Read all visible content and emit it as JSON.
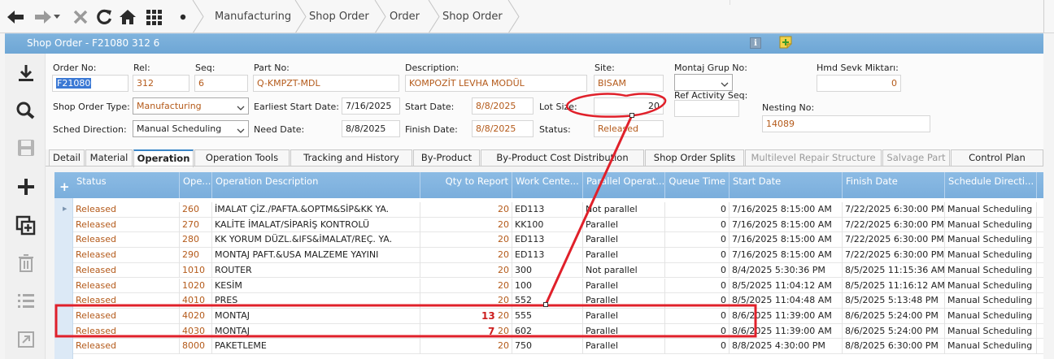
{
  "breadcrumb": [
    "Manufacturing",
    "Shop Order",
    "Order",
    "Shop Order"
  ],
  "title": "Shop Order - F21080 312 6",
  "form": {
    "order_no_label": "Order No:",
    "order_no": "F21080",
    "rel_label": "Rel:",
    "rel": "312",
    "seq_label": "Seq:",
    "seq": "6",
    "part_no_label": "Part No:",
    "part_no": "Q-KMPZT-MDL",
    "description_label": "Description:",
    "description": "KOMPOZİT LEVHA MODÜL",
    "site_label": "Site:",
    "site": "BISAM",
    "montaj_grup_label": "Montaj Grup No:",
    "hmd_sevk_label": "Hmd Sevk Miktarı:",
    "hmd_sevk": "0",
    "shop_order_type_label": "Shop Order Type:",
    "shop_order_type": "Manufacturing",
    "earliest_start_label": "Earliest Start Date:",
    "earliest_start": "7/16/2025",
    "start_date_label": "Start Date:",
    "start_date": "8/8/2025",
    "lot_size_label": "Lot Size:",
    "lot_size": "20",
    "ref_activity_label": "Ref Activity Seq:",
    "nesting_label": "Nesting No:",
    "nesting": "14089",
    "sched_direction_label": "Sched Direction:",
    "sched_direction": "Manual Scheduling",
    "need_date_label": "Need Date:",
    "need_date": "8/8/2025",
    "finish_date_label": "Finish Date:",
    "finish_date": "8/8/2025",
    "status_label": "Status:",
    "status": "Released"
  },
  "tabs": [
    {
      "label": "Detail"
    },
    {
      "label": "Material"
    },
    {
      "label": "Operation"
    },
    {
      "label": "Operation Tools"
    },
    {
      "label": "Tracking and History"
    },
    {
      "label": "By-Product"
    },
    {
      "label": "By-Product Cost Distribution"
    },
    {
      "label": "Shop Order Splits"
    },
    {
      "label": "Multilevel Repair Structure"
    },
    {
      "label": "Salvage Part"
    },
    {
      "label": "Control Plan"
    }
  ],
  "grid": {
    "columns": [
      "Status",
      "Ope...",
      "Operation Description",
      "Qty to Report",
      "Work Cente...",
      "Parallel Operat...",
      "Queue Time",
      "Start Date",
      "Finish Date",
      "Schedule Directi..."
    ],
    "rows": [
      {
        "status": "Released",
        "op": "260",
        "desc": "İMALAT ÇİZ./PAFTA.&OPTM&SİP&KK YA.",
        "qty": "20",
        "wc": "ED113",
        "parallel": "Not parallel",
        "queue": "0",
        "start": "7/16/2025 8:15:00 AM",
        "finish": "7/22/2025 6:30:00 PM",
        "sched": "Manual Scheduling",
        "extra": ""
      },
      {
        "status": "Released",
        "op": "270",
        "desc": "KALİTE İMALAT/SİPARİŞ KONTROLÜ",
        "qty": "20",
        "wc": "KK100",
        "parallel": "Parallel",
        "queue": "0",
        "start": "7/16/2025 8:15:00 AM",
        "finish": "7/22/2025 6:30:00 PM",
        "sched": "Manual Scheduling",
        "extra": ""
      },
      {
        "status": "Released",
        "op": "280",
        "desc": "KK YORUM DÜZL.&IFS&İMALAT/REÇ. YA.",
        "qty": "20",
        "wc": "ED113",
        "parallel": "Parallel",
        "queue": "0",
        "start": "7/16/2025 8:15:00 AM",
        "finish": "7/22/2025 6:30:00 PM",
        "sched": "Manual Scheduling",
        "extra": ""
      },
      {
        "status": "Released",
        "op": "290",
        "desc": "MONTAJ PAFT.&USA MALZEME YAYINI",
        "qty": "20",
        "wc": "ED113",
        "parallel": "Parallel",
        "queue": "0",
        "start": "7/16/2025 8:15:00 AM",
        "finish": "7/22/2025 6:30:00 PM",
        "sched": "Manual Scheduling",
        "extra": ""
      },
      {
        "status": "Released",
        "op": "1010",
        "desc": "ROUTER",
        "qty": "20",
        "wc": "300",
        "parallel": "Not parallel",
        "queue": "0",
        "start": "8/4/2025 5:30:36 PM",
        "finish": "8/5/2025 11:15:36 AM",
        "sched": "Manual Scheduling",
        "extra": ""
      },
      {
        "status": "Released",
        "op": "1020",
        "desc": "KESİM",
        "qty": "20",
        "wc": "100",
        "parallel": "Parallel",
        "queue": "0",
        "start": "8/5/2025 11:04:12 AM",
        "finish": "8/5/2025 11:16:12 AM",
        "sched": "Manual Scheduling",
        "extra": ""
      },
      {
        "status": "Released",
        "op": "4010",
        "desc": "PRES",
        "qty": "20",
        "wc": "552",
        "parallel": "Parallel",
        "queue": "0",
        "start": "8/5/2025 11:04:48 AM",
        "finish": "8/5/2025 5:13:48 PM",
        "sched": "Manual Scheduling",
        "extra": ""
      },
      {
        "status": "Released",
        "op": "4020",
        "desc": "MONTAJ",
        "qty": "20",
        "wc": "555",
        "parallel": "Parallel",
        "queue": "0",
        "start": "8/6/2025 11:39:00 AM",
        "finish": "8/6/2025 5:24:00 PM",
        "sched": "Manual Scheduling",
        "extra": "13"
      },
      {
        "status": "Released",
        "op": "4030",
        "desc": "MONTAJ",
        "qty": "20",
        "wc": "602",
        "parallel": "Parallel",
        "queue": "0",
        "start": "8/6/2025 11:39:00 AM",
        "finish": "8/6/2025 5:24:00 PM",
        "sched": "Manual Scheduling",
        "extra": "7"
      },
      {
        "status": "Released",
        "op": "8000",
        "desc": "PAKETLEME",
        "qty": "20",
        "wc": "750",
        "parallel": "Parallel",
        "queue": "0",
        "start": "8/8/2025 4:30:00 PM",
        "finish": "8/8/2025 6:30:00 PM",
        "sched": "Manual Scheduling",
        "extra": ""
      }
    ]
  },
  "colors": {
    "accent": "#6ea6d5",
    "status_orange": "#b45a1a",
    "annotation_red": "#e0202a"
  }
}
